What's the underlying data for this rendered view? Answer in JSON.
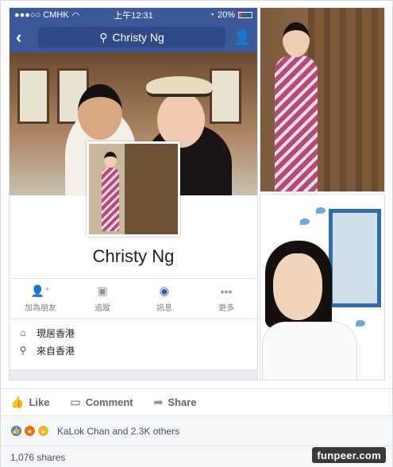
{
  "status_bar": {
    "carrier": "●●●○○ CMHK",
    "time": "上午12:31",
    "battery": "20%"
  },
  "nav": {
    "back_icon": "back-arrow-icon",
    "search_text": "Christy Ng",
    "search_icon": "search-icon",
    "menu_icon": "profile-menu-icon"
  },
  "profile": {
    "name": "Christy Ng",
    "actions": [
      {
        "label": "加為朋友",
        "icon": "add-friend-icon"
      },
      {
        "label": "追蹤",
        "icon": "follow-icon"
      },
      {
        "label": "訊息",
        "icon": "messenger-icon"
      },
      {
        "label": "更多",
        "icon": "more-icon"
      }
    ],
    "info": [
      {
        "text": "現居香港",
        "icon": "home-icon"
      },
      {
        "text": "來自香港",
        "icon": "location-pin-icon"
      }
    ]
  },
  "post_actions": {
    "like": "Like",
    "comment": "Comment",
    "share": "Share"
  },
  "reactions": {
    "text": "KaLok Chan and 2.3K others"
  },
  "shares": {
    "text": "1,076 shares"
  },
  "watermark": {
    "text": "funpeer.com"
  }
}
